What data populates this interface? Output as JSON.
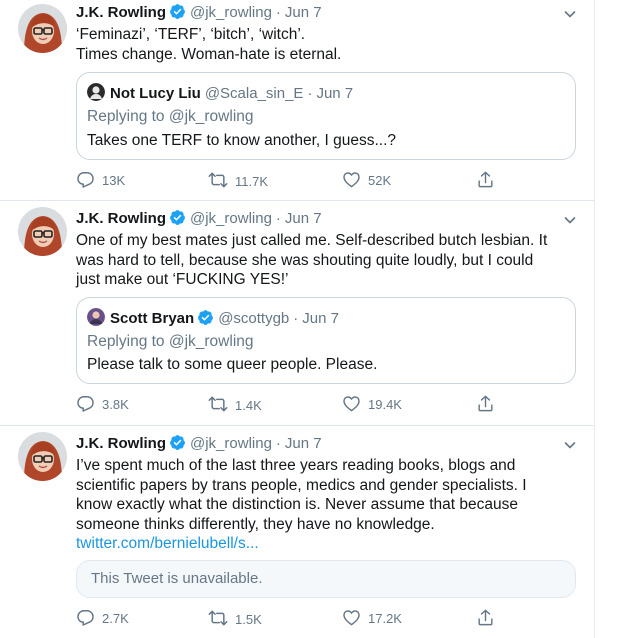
{
  "tweets": [
    {
      "author": {
        "name": "J.K. Rowling",
        "handle": "@jk_rowling",
        "date": "Jun 7"
      },
      "lines": [
        "‘Feminazi’, ‘TERF’, ‘bitch’, ‘witch’.",
        "Times change. Woman-hate is eternal."
      ],
      "quote": {
        "name": "Not Lucy Liu",
        "handle": "@Scala_sin_E",
        "date": "Jun 7",
        "replying": "Replying to @jk_rowling",
        "text": "Takes one TERF to know another, I guess...?"
      },
      "stats": {
        "replies": "13K",
        "retweets": "11.7K",
        "likes": "52K"
      }
    },
    {
      "author": {
        "name": "J.K. Rowling",
        "handle": "@jk_rowling",
        "date": "Jun 7"
      },
      "lines": [
        "One of my best mates just called me. Self-described butch lesbian. It",
        "was hard to tell, because she was shouting quite loudly, but I could",
        "just make out ‘FUCKING YES!’"
      ],
      "quote": {
        "name": "Scott Bryan",
        "handle": "@scottygb",
        "date": "Jun 7",
        "replying": "Replying to @jk_rowling",
        "text": "Please talk to some queer people. Please."
      },
      "stats": {
        "replies": "3.8K",
        "retweets": "1.4K",
        "likes": "19.4K"
      }
    },
    {
      "author": {
        "name": "J.K. Rowling",
        "handle": "@jk_rowling",
        "date": "Jun 7"
      },
      "lines": [
        "I’ve spent much of the last three years reading books, blogs and",
        "scientific papers by trans people, medics and gender specialists. I",
        "know exactly what the distinction is. Never assume that because",
        "someone thinks differently, they have no knowledge."
      ],
      "link": "twitter.com/bernielubell/s...",
      "unavailable": "This Tweet is unavailable.",
      "stats": {
        "replies": "2.7K",
        "retweets": "1.5K",
        "likes": "17.2K"
      }
    }
  ],
  "icons": {
    "reply": "reply-icon",
    "retweet": "retweet-icon",
    "like": "heart-icon",
    "share": "share-icon",
    "menu": "chevron-down-icon",
    "verified": "verified-badge-icon"
  },
  "colors": {
    "text": "#14171a",
    "secondary": "#657786",
    "link": "#1b95e0",
    "verified": "#1da1f2",
    "border": "#e1e8ed"
  }
}
